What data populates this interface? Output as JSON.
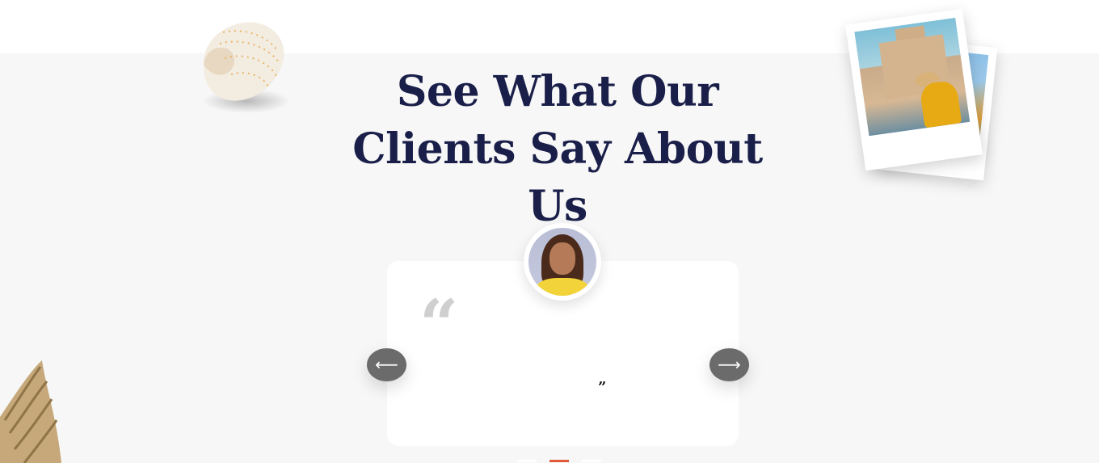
{
  "section": {
    "title": "See What Our Clients Say About Us"
  },
  "testimonial": {
    "quote_open": "“",
    "quote_close": "”",
    "avatar_icon": "client-avatar"
  },
  "navigation": {
    "prev_icon": "arrow-left-icon",
    "prev_glyph": "⟵",
    "next_icon": "arrow-right-icon",
    "next_glyph": "⟶"
  },
  "pagination": {
    "count": 3,
    "active_index": 1
  },
  "decorations": [
    "seashell-image",
    "polaroid-photos-image",
    "rope-image"
  ],
  "colors": {
    "title": "#1a1f4a",
    "background_band": "#f7f7f7",
    "card": "#ffffff",
    "nav_button": "#6b6b6b",
    "active_dot": "#e05a3a",
    "quote_mark": "#cfcfcf"
  }
}
